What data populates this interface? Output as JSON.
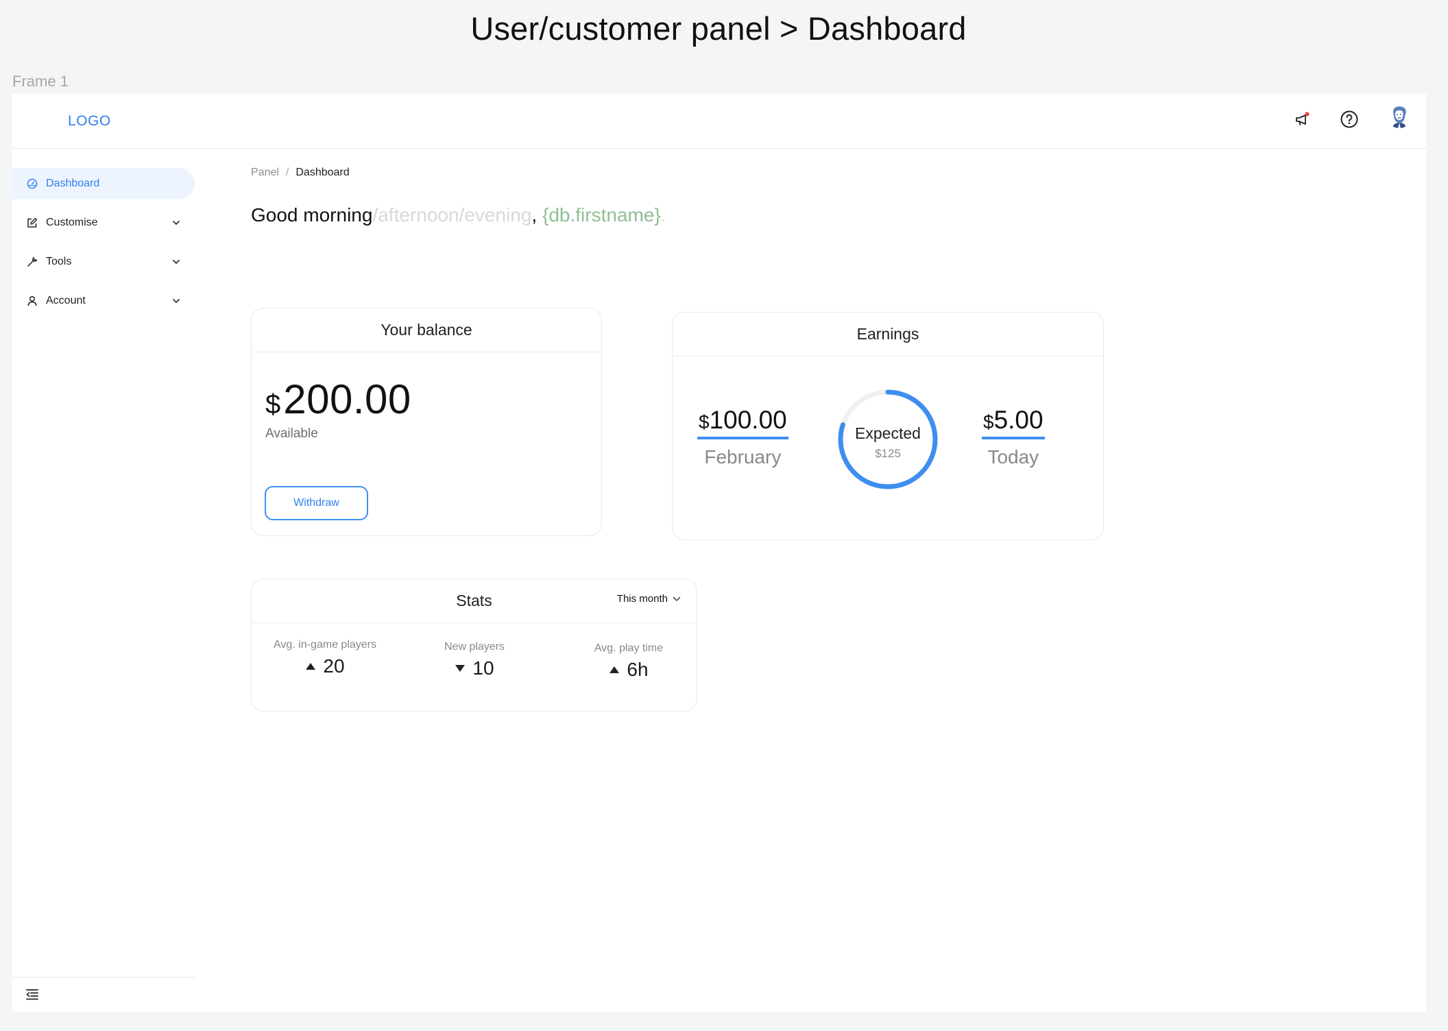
{
  "canvas": {
    "heading": "User/customer panel > Dashboard",
    "frame_label": "Frame 1"
  },
  "topbar": {
    "logo": "LOGO",
    "icons": [
      "megaphone-icon",
      "help-circle-icon",
      "avatar"
    ],
    "notification_dot_color": "#ef3e36"
  },
  "sidebar": {
    "items": [
      {
        "label": "Dashboard",
        "icon": "dashboard-gauge-icon",
        "active": true,
        "expandable": false
      },
      {
        "label": "Customise",
        "icon": "edit-icon",
        "active": false,
        "expandable": true
      },
      {
        "label": "Tools",
        "icon": "wrench-icon",
        "active": false,
        "expandable": true
      },
      {
        "label": "Account",
        "icon": "user-icon",
        "active": false,
        "expandable": true
      }
    ],
    "footer_icon": "collapse-menu-icon"
  },
  "breadcrumb": {
    "items": [
      "Panel",
      "Dashboard"
    ],
    "separator": "/"
  },
  "greeting": {
    "main": "Good morning",
    "alternates": "/afternoon/evening",
    "comma": ",",
    "variable": "{db.firstname}",
    "end": "."
  },
  "balance": {
    "title": "Your balance",
    "currency": "$",
    "amount": "200.00",
    "label": "Available",
    "button": "Withdraw"
  },
  "earnings": {
    "title": "Earnings",
    "left": {
      "currency": "$",
      "amount": "100.00",
      "label": "February"
    },
    "center": {
      "label": "Expected",
      "value": "$125",
      "progress": 0.8
    },
    "right": {
      "currency": "$",
      "amount": "5.00",
      "label": "Today"
    }
  },
  "stats": {
    "title": "Stats",
    "filter": "This month",
    "items": [
      {
        "label": "Avg. in-game players",
        "value": "20",
        "trend": "up"
      },
      {
        "label": "New players",
        "value": "10",
        "trend": "down"
      },
      {
        "label": "Avg. play time",
        "value": "6h",
        "trend": "up"
      }
    ]
  },
  "colors": {
    "accent": "#2f80ed",
    "active_bg": "#eef4fd",
    "ring": "#3d8ef0",
    "ring_track": "#f0f0f0",
    "variable_text": "#8fbf94"
  }
}
